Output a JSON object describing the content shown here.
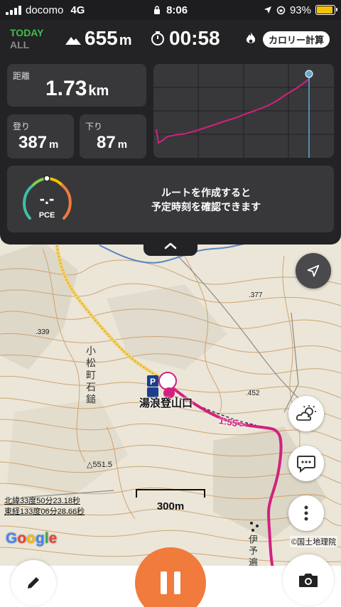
{
  "status_bar": {
    "carrier": "docomo",
    "network": "4G",
    "time": "8:06",
    "battery": "93%"
  },
  "summary": {
    "period_active": "TODAY",
    "period_other": "ALL",
    "elevation_value": "655",
    "elevation_unit": "m",
    "elapsed_time": "00:58",
    "calorie_button": "カロリー計算"
  },
  "stats": {
    "distance_label": "距離",
    "distance_value": "1.73",
    "distance_unit": "km",
    "ascent_label": "登り",
    "ascent_value": "387",
    "ascent_unit": "m",
    "descent_label": "下り",
    "descent_value": "87",
    "descent_unit": "m"
  },
  "pce": {
    "gauge_value": "-.-",
    "gauge_label": "PCE",
    "message_line1": "ルートを作成すると",
    "message_line2": "予定時刻を確認できます"
  },
  "map": {
    "spot_elevations": [
      ".377",
      ".339",
      ".452",
      "△551.5"
    ],
    "mountain_name": "小松町石鎚",
    "trailhead": "湯浪登山口",
    "pace": "1:55 >",
    "scale_label": "300m",
    "latitude": "北緯33度50分23.18秒",
    "longitude": "東経133度06分28.66秒",
    "google": "Google",
    "gsi_credit": "©国土地理院",
    "route_name": "伊予遍",
    "colors": {
      "track": "#d2217f",
      "contour": "#c9955a",
      "road_yellow": "#f3d26a",
      "river": "#5b86c4"
    }
  },
  "colors": {
    "panel": "#232325",
    "card": "#38383a",
    "today": "#3fbf4a",
    "pause_button": "#f07b3c"
  }
}
